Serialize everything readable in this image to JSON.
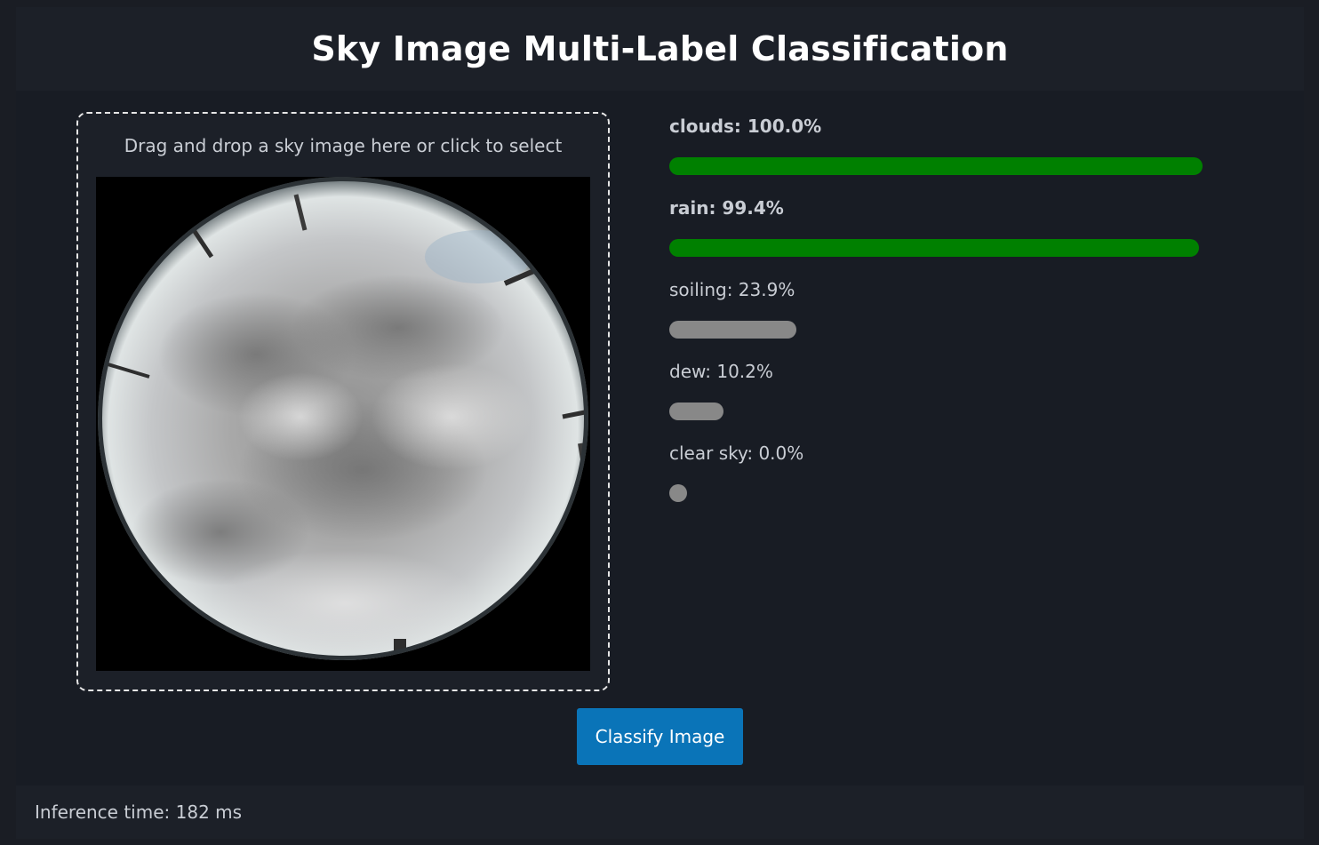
{
  "header": {
    "title": "Sky Image Multi-Label Classification"
  },
  "dropzone": {
    "prompt": "Drag and drop a sky image here or click to select"
  },
  "results": [
    {
      "label": "clouds: 100.0%",
      "value": 1.0,
      "active": true,
      "color": "#008000"
    },
    {
      "label": "rain: 99.4%",
      "value": 0.994,
      "active": true,
      "color": "#008000"
    },
    {
      "label": "soiling: 23.9%",
      "value": 0.239,
      "active": false,
      "color": "#888888"
    },
    {
      "label": "dew: 10.2%",
      "value": 0.102,
      "active": false,
      "color": "#888888"
    },
    {
      "label": "clear sky: 0.0%",
      "value": 0.0,
      "active": false,
      "color": "#888888"
    }
  ],
  "actions": {
    "classify_label": "Classify Image"
  },
  "footer": {
    "inference_text": "Inference time: 182 ms"
  }
}
